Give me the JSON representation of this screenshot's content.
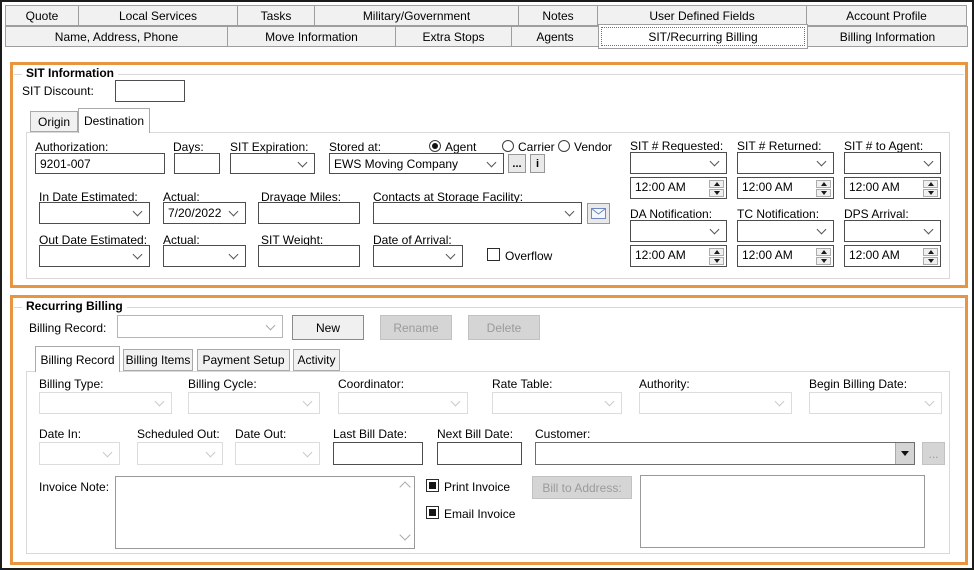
{
  "tabs_row1": [
    "Quote",
    "Local Services",
    "Tasks",
    "Military/Government",
    "Notes",
    "User Defined Fields",
    "Account Profile"
  ],
  "tabs_row2": [
    "Name, Address, Phone",
    "Move Information",
    "Extra Stops",
    "Agents",
    "SIT/Recurring Billing",
    "Billing Information"
  ],
  "tabs_row2_selected": "SIT/Recurring Billing",
  "sit": {
    "legend": "SIT Information",
    "discount_label": "SIT Discount:",
    "discount_value": "",
    "tabs": [
      "Origin",
      "Destination"
    ],
    "active_tab": "Destination",
    "authorization": {
      "label": "Authorization:",
      "value": "9201-007"
    },
    "days": {
      "label": "Days:",
      "value": ""
    },
    "sit_expiration": {
      "label": "SIT Expiration:",
      "value": ""
    },
    "stored_at": {
      "label": "Stored at:",
      "options": [
        "Agent",
        "Carrier",
        "Vendor"
      ],
      "selected": "Agent"
    },
    "storage_company": {
      "value": "EWS Moving Company",
      "more_button": "...",
      "info_button": "i"
    },
    "in_date_estimated": {
      "label": "In Date Estimated:",
      "value": ""
    },
    "in_date_actual": {
      "label": "Actual:",
      "value": "7/20/2022"
    },
    "drayage_miles": {
      "label": "Drayage Miles:",
      "value": ""
    },
    "contacts": {
      "label": "Contacts at Storage Facility:",
      "value": ""
    },
    "out_date_estimated": {
      "label": "Out Date Estimated:",
      "value": ""
    },
    "out_date_actual": {
      "label": "Actual:",
      "value": ""
    },
    "sit_weight": {
      "label": "SIT Weight:",
      "value": ""
    },
    "date_of_arrival": {
      "label": "Date of Arrival:",
      "value": ""
    },
    "overflow": {
      "label": "Overflow",
      "checked": false
    },
    "sit_requested": {
      "label": "SIT # Requested:",
      "value": "",
      "time": "12:00 AM"
    },
    "sit_returned": {
      "label": "SIT # Returned:",
      "value": "",
      "time": "12:00 AM"
    },
    "sit_to_agent": {
      "label": "SIT # to Agent:",
      "value": "",
      "time": "12:00 AM"
    },
    "da_notification": {
      "label": "DA Notification:",
      "value": "",
      "time": "12:00 AM"
    },
    "tc_notification": {
      "label": "TC Notification:",
      "value": "",
      "time": "12:00 AM"
    },
    "dps_arrival": {
      "label": "DPS Arrival:",
      "value": "",
      "time": "12:00 AM"
    }
  },
  "recurring": {
    "legend": "Recurring Billing",
    "billing_record": {
      "label": "Billing Record:",
      "value": ""
    },
    "buttons": {
      "new": "New",
      "rename": "Rename",
      "delete": "Delete"
    },
    "tabs": [
      "Billing Record",
      "Billing Items",
      "Payment Setup",
      "Activity"
    ],
    "active_tab": "Billing Record",
    "billing_type": {
      "label": "Billing Type:",
      "value": ""
    },
    "billing_cycle": {
      "label": "Billing Cycle:",
      "value": ""
    },
    "coordinator": {
      "label": "Coordinator:",
      "value": ""
    },
    "rate_table": {
      "label": "Rate Table:",
      "value": ""
    },
    "authority": {
      "label": "Authority:",
      "value": ""
    },
    "begin_billing_date": {
      "label": "Begin Billing Date:",
      "value": ""
    },
    "date_in": {
      "label": "Date In:",
      "value": ""
    },
    "scheduled_out": {
      "label": "Scheduled Out:",
      "value": ""
    },
    "date_out": {
      "label": "Date Out:",
      "value": ""
    },
    "last_bill_date": {
      "label": "Last Bill Date:",
      "value": ""
    },
    "next_bill_date": {
      "label": "Next Bill Date:",
      "value": ""
    },
    "customer": {
      "label": "Customer:",
      "value": "",
      "more_button": "..."
    },
    "invoice_note": {
      "label": "Invoice Note:",
      "value": ""
    },
    "print_invoice": {
      "label": "Print Invoice",
      "checked": true
    },
    "email_invoice": {
      "label": "Email Invoice",
      "checked": true
    },
    "bill_to_address_button": "Bill to Address:",
    "bill_to_address_value": ""
  },
  "colors": {
    "accent_orange": "#E8953F",
    "disabled_gray": "#D5D5D5"
  }
}
